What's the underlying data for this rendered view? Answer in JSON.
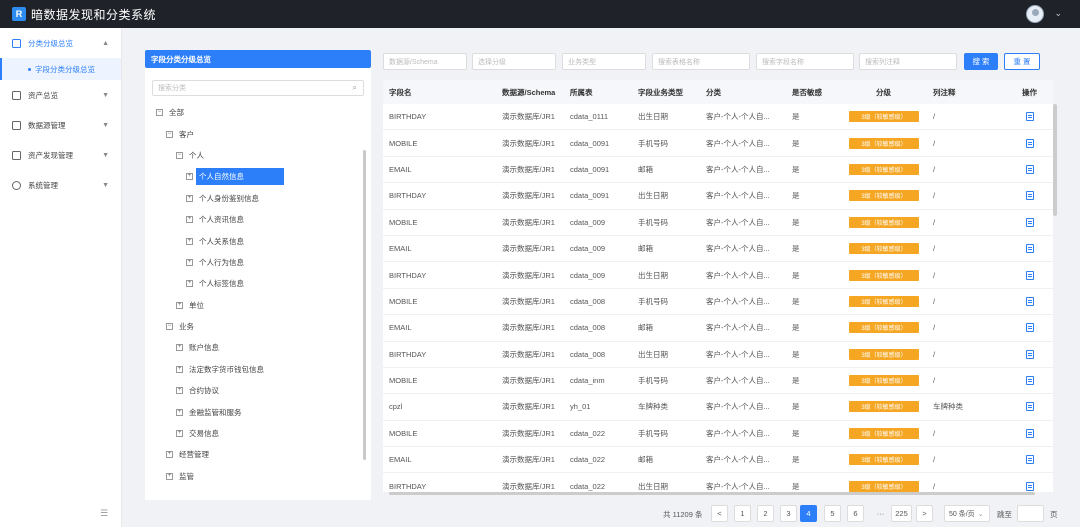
{
  "header": {
    "logo_text": "R",
    "title": "暗数据发现和分类系统"
  },
  "sidebar": {
    "items": [
      {
        "label": "分类分级总览",
        "arrow": "▲"
      },
      {
        "label": "字段分类分级总览"
      },
      {
        "label": "资产总览",
        "arrow": "▼"
      },
      {
        "label": "数据源管理",
        "arrow": "▼"
      },
      {
        "label": "资产发现管理",
        "arrow": "▼"
      },
      {
        "label": "系统管理",
        "arrow": "▼"
      }
    ],
    "collapse_glyph": "☰"
  },
  "tree": {
    "title": "字段分类分级总览",
    "search_placeholder": "搜索分类",
    "nodes": [
      {
        "label": "全部",
        "level": 0,
        "mark": "−"
      },
      {
        "label": "客户",
        "level": 1,
        "mark": "−"
      },
      {
        "label": "个人",
        "level": 2,
        "mark": "−"
      },
      {
        "label": "个人自然信息",
        "level": 3,
        "mark": "+",
        "selected": true
      },
      {
        "label": "个人身份鉴别信息",
        "level": 3,
        "mark": "+"
      },
      {
        "label": "个人资讯信息",
        "level": 3,
        "mark": "+"
      },
      {
        "label": "个人关系信息",
        "level": 3,
        "mark": "+"
      },
      {
        "label": "个人行为信息",
        "level": 3,
        "mark": "+"
      },
      {
        "label": "个人标签信息",
        "level": 3,
        "mark": "+"
      },
      {
        "label": "单位",
        "level": 2,
        "mark": "+"
      },
      {
        "label": "业务",
        "level": 1,
        "mark": "−"
      },
      {
        "label": "账户信息",
        "level": 2,
        "mark": "+"
      },
      {
        "label": "法定数字货币钱包信息",
        "level": 2,
        "mark": "+"
      },
      {
        "label": "合约协议",
        "level": 2,
        "mark": "+"
      },
      {
        "label": "金融监管和服务",
        "level": 2,
        "mark": "+"
      },
      {
        "label": "交易信息",
        "level": 2,
        "mark": "+"
      },
      {
        "label": "经营管理",
        "level": 1,
        "mark": "+"
      },
      {
        "label": "监管",
        "level": 1,
        "mark": "+"
      }
    ]
  },
  "filters": {
    "datasource": "数据源/Schema",
    "level": "选择分级",
    "biz_type": "业务类型",
    "table_name": "搜索表格名称",
    "field_name": "搜索字段名称",
    "column_comment": "搜索列注释",
    "search_label": "搜 索",
    "reset_label": "重 置"
  },
  "table": {
    "columns": [
      "字段名",
      "数据源/Schema",
      "所属表",
      "字段业务类型",
      "分类",
      "是否敏感",
      "分级",
      "列注释",
      "操作"
    ],
    "rows": [
      [
        "BIRTHDAY",
        "演示数据库/JR1",
        "cdata_0111",
        "出生日期",
        "客户-个人-个人自...",
        "是",
        "3级（较敏感级）",
        "/"
      ],
      [
        "MOBILE",
        "演示数据库/JR1",
        "cdata_0091",
        "手机号码",
        "客户-个人-个人自...",
        "是",
        "3级（较敏感级）",
        "/"
      ],
      [
        "EMAIL",
        "演示数据库/JR1",
        "cdata_0091",
        "邮箱",
        "客户-个人-个人自...",
        "是",
        "3级（较敏感级）",
        "/"
      ],
      [
        "BIRTHDAY",
        "演示数据库/JR1",
        "cdata_0091",
        "出生日期",
        "客户-个人-个人自...",
        "是",
        "3级（较敏感级）",
        "/"
      ],
      [
        "MOBILE",
        "演示数据库/JR1",
        "cdata_009",
        "手机号码",
        "客户-个人-个人自...",
        "是",
        "3级（较敏感级）",
        "/"
      ],
      [
        "EMAIL",
        "演示数据库/JR1",
        "cdata_009",
        "邮箱",
        "客户-个人-个人自...",
        "是",
        "3级（较敏感级）",
        "/"
      ],
      [
        "BIRTHDAY",
        "演示数据库/JR1",
        "cdata_009",
        "出生日期",
        "客户-个人-个人自...",
        "是",
        "3级（较敏感级）",
        "/"
      ],
      [
        "MOBILE",
        "演示数据库/JR1",
        "cdata_008",
        "手机号码",
        "客户-个人-个人自...",
        "是",
        "3级（较敏感级）",
        "/"
      ],
      [
        "EMAIL",
        "演示数据库/JR1",
        "cdata_008",
        "邮箱",
        "客户-个人-个人自...",
        "是",
        "3级（较敏感级）",
        "/"
      ],
      [
        "BIRTHDAY",
        "演示数据库/JR1",
        "cdata_008",
        "出生日期",
        "客户-个人-个人自...",
        "是",
        "3级（较敏感级）",
        "/"
      ],
      [
        "MOBILE",
        "演示数据库/JR1",
        "cdata_inm",
        "手机号码",
        "客户-个人-个人自...",
        "是",
        "3级（较敏感级）",
        "/"
      ],
      [
        "cpzl",
        "演示数据库/JR1",
        "yh_01",
        "车牌种类",
        "客户-个人-个人自...",
        "是",
        "3级（较敏感级）",
        "车牌种类"
      ],
      [
        "MOBILE",
        "演示数据库/JR1",
        "cdata_022",
        "手机号码",
        "客户-个人-个人自...",
        "是",
        "3级（较敏感级）",
        "/"
      ],
      [
        "EMAIL",
        "演示数据库/JR1",
        "cdata_022",
        "邮箱",
        "客户-个人-个人自...",
        "是",
        "3级（较敏感级）",
        "/"
      ],
      [
        "BIRTHDAY",
        "演示数据库/JR1",
        "cdata_022",
        "出生日期",
        "客户-个人-个人自...",
        "是",
        "3级（较敏感级）",
        "/"
      ]
    ]
  },
  "pagination": {
    "total": "共 11209 条",
    "prev": "<",
    "next": ">",
    "pages": [
      "1",
      "2",
      "3",
      "4",
      "5",
      "6",
      "···",
      "225"
    ],
    "active_page": "4",
    "page_size": "50 条/页",
    "jump_label": "跳至",
    "page_unit": "页"
  },
  "colors": {
    "primary": "#2d7ff9",
    "tag": "#f5a623",
    "header_bg": "#1f2229"
  }
}
